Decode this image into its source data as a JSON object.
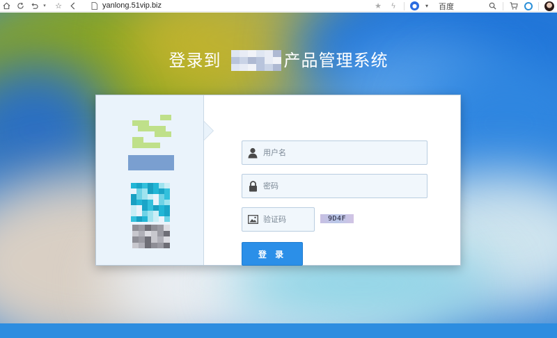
{
  "browser": {
    "url": "yanlong.51vip.biz",
    "search_engine": "百度"
  },
  "page": {
    "title_prefix": "登录到",
    "title_suffix": "产品管理系统"
  },
  "form": {
    "username_placeholder": "用户名",
    "password_placeholder": "密码",
    "captcha_placeholder": "验证码",
    "captcha_code": "9D4F",
    "login_label": "登 录"
  },
  "colors": {
    "accent": "#2b8fe8",
    "card_left_bg": "#eaf3fb",
    "bottom_bar": "#2d8de0"
  }
}
